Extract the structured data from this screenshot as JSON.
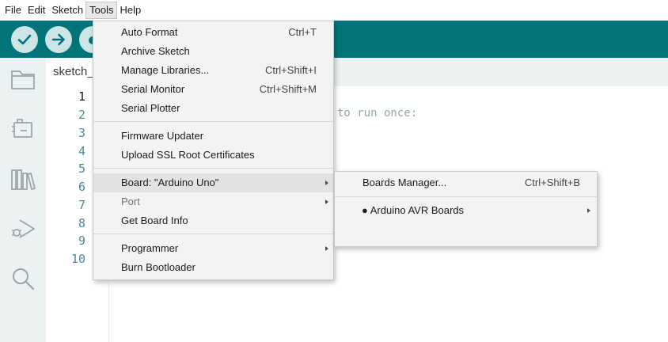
{
  "menubar": {
    "items": [
      {
        "label": "File"
      },
      {
        "label": "Edit"
      },
      {
        "label": "Sketch"
      },
      {
        "label": "Tools",
        "active": true
      },
      {
        "label": "Help"
      }
    ]
  },
  "toolbar": {
    "verify_icon": "checkmark-icon",
    "upload_icon": "arrow-right-icon"
  },
  "sidebar": {
    "icons": [
      "folder-icon",
      "board-icon",
      "library-icon",
      "debug-icon",
      "search-icon"
    ]
  },
  "editor": {
    "tab_label": "sketch_",
    "line_numbers": [
      "1",
      "2",
      "3",
      "4",
      "5",
      "6",
      "7",
      "8",
      "9",
      "10"
    ],
    "current_line": 1,
    "visible_comment": "to run once:"
  },
  "tools_menu": {
    "items": [
      {
        "label": "Auto Format",
        "shortcut": "Ctrl+T"
      },
      {
        "label": "Archive Sketch",
        "shortcut": ""
      },
      {
        "label": "Manage Libraries...",
        "shortcut": "Ctrl+Shift+I"
      },
      {
        "label": "Serial Monitor",
        "shortcut": "Ctrl+Shift+M"
      },
      {
        "label": "Serial Plotter",
        "shortcut": ""
      },
      {
        "label": "Firmware Updater",
        "shortcut": ""
      },
      {
        "label": "Upload SSL Root Certificates",
        "shortcut": ""
      },
      {
        "label": "Board: \"Arduino Uno\"",
        "shortcut": "",
        "submenu": true,
        "highlighted": true
      },
      {
        "label": "Port",
        "shortcut": "",
        "submenu": true,
        "disabled": true
      },
      {
        "label": "Get Board Info",
        "shortcut": ""
      },
      {
        "label": "Programmer",
        "shortcut": "",
        "submenu": true
      },
      {
        "label": "Burn Bootloader",
        "shortcut": ""
      }
    ]
  },
  "board_submenu": {
    "items": [
      {
        "label": "Boards Manager...",
        "shortcut": "Ctrl+Shift+B"
      },
      {
        "label": "● Arduino AVR Boards",
        "shortcut": "",
        "submenu": true
      }
    ]
  },
  "colors": {
    "toolbar": "#007479",
    "button_bg": "#cde5e6",
    "sidebar": "#ecf1f1",
    "line_number": "#4a8a99",
    "comment": "#95a5a6",
    "menu_bg": "#f3f3f3",
    "menu_highlight": "#e2e2e2"
  }
}
